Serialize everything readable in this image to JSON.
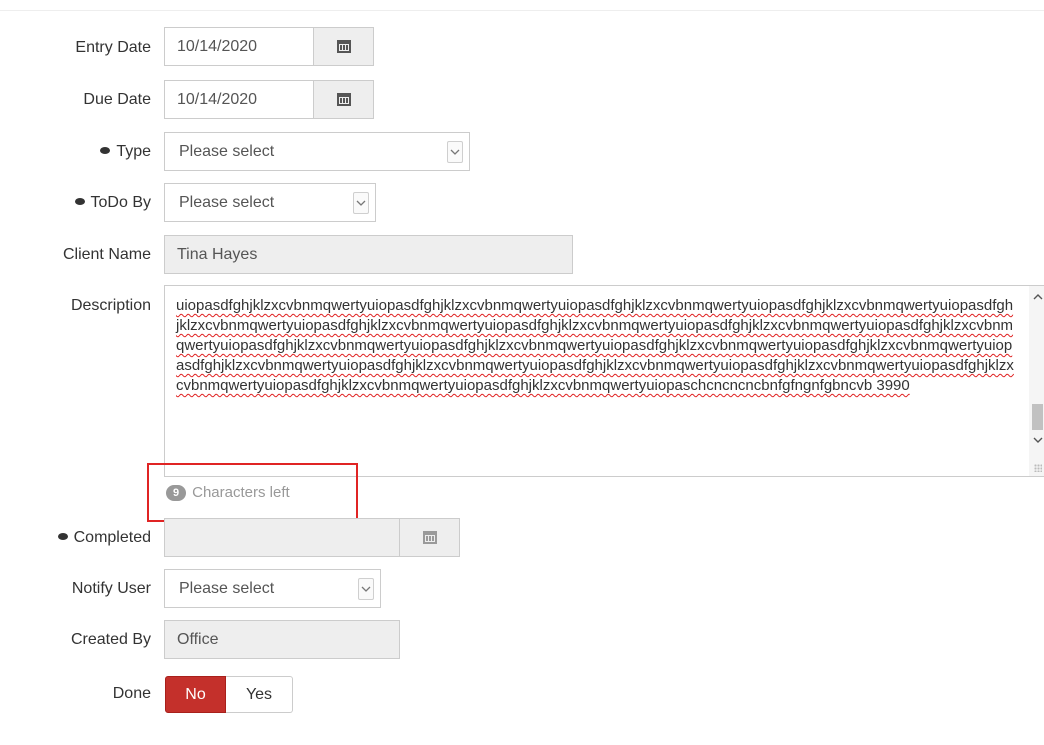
{
  "form": {
    "entry_date": {
      "label": "Entry Date",
      "value": "10/14/2020",
      "icon": "calendar-icon"
    },
    "due_date": {
      "label": "Due Date",
      "value": "10/14/2020",
      "icon": "calendar-icon"
    },
    "type": {
      "label": "Type",
      "value": "Please select",
      "icon": "eye-icon"
    },
    "todo_by": {
      "label": "ToDo By",
      "value": "Please select",
      "icon": "eye-icon"
    },
    "client_name": {
      "label": "Client Name",
      "value": "Tina Hayes"
    },
    "description": {
      "label": "Description",
      "value": "uiopasdfghjklzxcvbnmqwertyuiopasdfghjklzxcvbnmqwertyuiopasdfghjklzxcvbnmqwertyuiopasdfghjklzxcvbnmqwertyuiopasdfghjklzxcvbnmqwertyuiopasdfghjklzxcvbnmqwertyuiopasdfghjklzxcvbnmqwertyuiopasdfghjklzxcvbnmqwertyuiopasdfghjklzxcvbnmqwertyuiopasdfghjklzxcvbnmqwertyuiopasdfghjklzxcvbnmqwertyuiopasdfghjklzxcvbnmqwertyuiopasdfghjklzxcvbnmqwertyuiopasdfghjklzxcvbnmqwertyuiopasdfghjklzxcvbnmqwertyuiopasdfghjklzxcvbnmqwertyuiopasdfghjklzxcvbnmqwertyuiopasdfghjklzxcvbnmqwertyuiopasdfghjklzxcvbnmqwertyuiopasdfghjklzxcvbnmqwertyuiopaschcncncncbnfgfngnfgbncvb 3990",
      "counter_value": "9",
      "counter_text": "Characters left",
      "highlight_color": "#e02424"
    },
    "completed": {
      "label": "Completed",
      "value": "",
      "icon": "eye-icon"
    },
    "notify_user": {
      "label": "Notify User",
      "value": "Please select"
    },
    "created_by": {
      "label": "Created By",
      "value": "Office"
    },
    "done": {
      "label": "Done",
      "options": [
        "No",
        "Yes"
      ],
      "selected": "No",
      "selected_color": "#c4302b"
    }
  }
}
